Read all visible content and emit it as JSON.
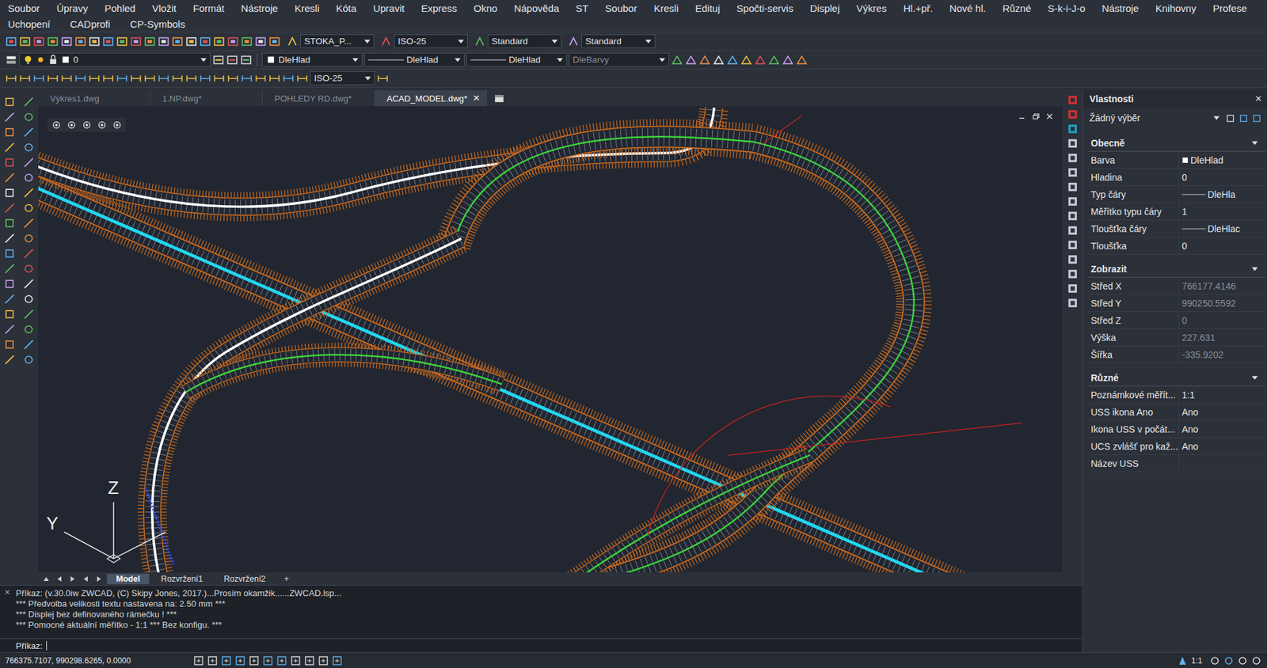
{
  "menu_bar": [
    [
      "Soubor",
      "Úpravy",
      "Pohled",
      "Vložit",
      "Formát",
      "Nástroje",
      "Kresli",
      "Kóta",
      "Upravit",
      "Express",
      "Okno",
      "Nápověda",
      "ST",
      "Soubor",
      "Kresli",
      "Edituj",
      "Spočti-servis",
      "Displej",
      "Výkres",
      "Hl.+př.",
      "Nové hl.",
      "Různé",
      "S-k-i-J-o",
      "Nástroje",
      "Knihovny",
      "Profese"
    ],
    [
      "Uchopení",
      "CADprofi",
      "CP-Symbols"
    ]
  ],
  "toolbar": {
    "row1_dropdowns": [
      {
        "label": "STOKA_P...",
        "disabled": false
      },
      {
        "label": "ISO-25",
        "disabled": false
      },
      {
        "label": "Standard",
        "disabled": false
      },
      {
        "label": "Standard",
        "disabled": false
      }
    ],
    "layer_dropdown": {
      "label": "0"
    },
    "property_dropdowns": [
      {
        "label": "DleHlad",
        "kind": "color",
        "disabled": false
      },
      {
        "label": "DleHlad",
        "kind": "line",
        "disabled": false
      },
      {
        "label": "DleHlad",
        "kind": "line",
        "disabled": false
      },
      {
        "label": "DleBarvy",
        "kind": "plain",
        "disabled": true
      }
    ],
    "row3_dropdown": {
      "label": "ISO-25",
      "disabled": false
    }
  },
  "document_tabs": [
    {
      "label": "Výkres1.dwg",
      "selected": false
    },
    {
      "label": "1.NP.dwg*",
      "selected": false
    },
    {
      "label": "POHLEDY RD.dwg*",
      "selected": false
    },
    {
      "label": "ACAD_MODEL.dwg*",
      "selected": true
    }
  ],
  "tab_close": "×",
  "canvas": {
    "axes": {
      "z": "Z",
      "y": "Y"
    }
  },
  "properties": {
    "title": "Vlastnosti",
    "close": "×",
    "selection": "Žádný výběr",
    "sections": [
      {
        "title": "Obecně",
        "expanded": true,
        "rows": [
          {
            "label": "Barva",
            "value": "DleHlad",
            "kind": "color",
            "disabled": false
          },
          {
            "label": "Hladina",
            "value": "0",
            "kind": "plain",
            "disabled": false
          },
          {
            "label": "Typ čáry",
            "value": "DleHla",
            "kind": "line",
            "disabled": false
          },
          {
            "label": "Měřítko typu čáry",
            "value": "1",
            "kind": "plain",
            "disabled": false
          },
          {
            "label": "Tloušťka čáry",
            "value": "DleHlac",
            "kind": "line",
            "disabled": false
          },
          {
            "label": "Tloušťka",
            "value": "0",
            "kind": "plain",
            "disabled": false
          }
        ]
      },
      {
        "title": "Zobrazit",
        "expanded": true,
        "rows": [
          {
            "label": "Střed X",
            "value": "766177.4146",
            "kind": "plain",
            "disabled": true
          },
          {
            "label": "Střed Y",
            "value": "990250.5592",
            "kind": "plain",
            "disabled": true
          },
          {
            "label": "Střed Z",
            "value": "0",
            "kind": "plain",
            "disabled": true
          },
          {
            "label": "Výška",
            "value": "227.631",
            "kind": "plain",
            "disabled": true
          },
          {
            "label": "Šířka",
            "value": "-335.9202",
            "kind": "plain",
            "disabled": true
          }
        ]
      },
      {
        "title": "Různé",
        "expanded": true,
        "rows": [
          {
            "label": "Poznámkové měřít...",
            "value": "1:1",
            "kind": "plain",
            "disabled": false
          },
          {
            "label": "USS ikona Ano",
            "value": "Ano",
            "kind": "plain",
            "disabled": false
          },
          {
            "label": "Ikona USS v počát...",
            "value": "Ano",
            "kind": "plain",
            "disabled": false
          },
          {
            "label": "UCS zvlášť pro kaž...",
            "value": "Ano",
            "kind": "plain",
            "disabled": false
          },
          {
            "label": "Název USS",
            "value": "",
            "kind": "plain",
            "disabled": false
          }
        ]
      }
    ]
  },
  "layout_tabs": [
    {
      "label": "Model",
      "selected": true
    },
    {
      "label": "Rozvržení1",
      "selected": false
    },
    {
      "label": "Rozvržení2",
      "selected": false
    }
  ],
  "layout_add": "+",
  "command_line": {
    "close": "×",
    "history": [
      "Příkaz: (v.30.0iw ZWCAD, (C) Skipy Jones, 2017.)...Prosím okamžik......ZWCAD.lsp...",
      "*** Předvolba velikosti textu nastavena na: 2.50 mm ***",
      "*** Displej bez definovaného rámečku ! ***",
      "*** Pomocné aktuální měřítko - 1:1 *** Bez konfigu. ***"
    ],
    "prompt": "Příkaz:"
  },
  "status_bar": {
    "coordinates": "766375.7107, 990298.6265, 0.0000",
    "scale": "1:1"
  }
}
